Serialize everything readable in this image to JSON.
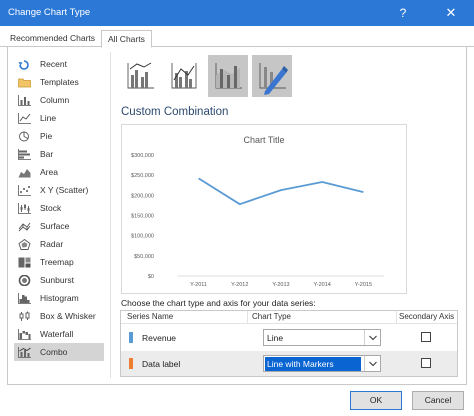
{
  "window": {
    "title": "Change Chart Type",
    "help_label": "?",
    "close_label": "✕"
  },
  "tabs": [
    {
      "label": "Recommended Charts",
      "active": false
    },
    {
      "label": "All Charts",
      "active": true
    }
  ],
  "sidebar": {
    "items": [
      {
        "label": "Recent",
        "icon": "recent-icon"
      },
      {
        "label": "Templates",
        "icon": "folder-icon"
      },
      {
        "label": "Column",
        "icon": "column-chart-icon"
      },
      {
        "label": "Line",
        "icon": "line-chart-icon"
      },
      {
        "label": "Pie",
        "icon": "pie-chart-icon"
      },
      {
        "label": "Bar",
        "icon": "bar-chart-icon"
      },
      {
        "label": "Area",
        "icon": "area-chart-icon"
      },
      {
        "label": "X Y (Scatter)",
        "icon": "scatter-chart-icon"
      },
      {
        "label": "Stock",
        "icon": "stock-chart-icon"
      },
      {
        "label": "Surface",
        "icon": "surface-chart-icon"
      },
      {
        "label": "Radar",
        "icon": "radar-chart-icon"
      },
      {
        "label": "Treemap",
        "icon": "treemap-chart-icon"
      },
      {
        "label": "Sunburst",
        "icon": "sunburst-chart-icon"
      },
      {
        "label": "Histogram",
        "icon": "histogram-chart-icon"
      },
      {
        "label": "Box & Whisker",
        "icon": "box-whisker-chart-icon"
      },
      {
        "label": "Waterfall",
        "icon": "waterfall-chart-icon"
      },
      {
        "label": "Combo",
        "icon": "combo-chart-icon",
        "selected": true
      }
    ]
  },
  "subtypes": [
    {
      "icon": "clustered-column-line-icon"
    },
    {
      "icon": "clustered-column-line-secondary-axis-icon"
    },
    {
      "icon": "stacked-area-clustered-column-icon"
    },
    {
      "icon": "custom-combination-icon",
      "selected": true
    }
  ],
  "main": {
    "heading": "Custom Combination",
    "instruction": "Choose the chart type and axis for your data series:"
  },
  "chart_data": {
    "type": "line",
    "title": "Chart Title",
    "categories": [
      "Y-2011",
      "Y-2012",
      "Y-2013",
      "Y-2014",
      "Y-2015"
    ],
    "y_tick_labels": [
      "$0",
      "$50,000",
      "$100,000",
      "$150,000",
      "$200,000",
      "$250,000",
      "$300,000"
    ],
    "ylim": [
      0,
      300000
    ],
    "grid": false,
    "series": [
      {
        "name": "Revenue",
        "values": [
          242000,
          178000,
          213000,
          233000,
          208000
        ],
        "color": "#5b9bd5"
      }
    ]
  },
  "series_table": {
    "headers": {
      "name": "Series Name",
      "type": "Chart Type",
      "axis": "Secondary Axis"
    },
    "rows": [
      {
        "name": "Revenue",
        "chart_type": "Line",
        "secondary": false,
        "color": "#5b9bd5",
        "selected": false
      },
      {
        "name": "Data label",
        "chart_type": "Line with Markers",
        "secondary": false,
        "color": "#ed7d31",
        "selected": true
      }
    ]
  },
  "buttons": {
    "ok": "OK",
    "cancel": "Cancel"
  },
  "colors": {
    "titlebar": "#2b78d6",
    "accent": "#0a64d2",
    "series_blue": "#5b9bd5",
    "series_orange": "#ed7d31"
  }
}
